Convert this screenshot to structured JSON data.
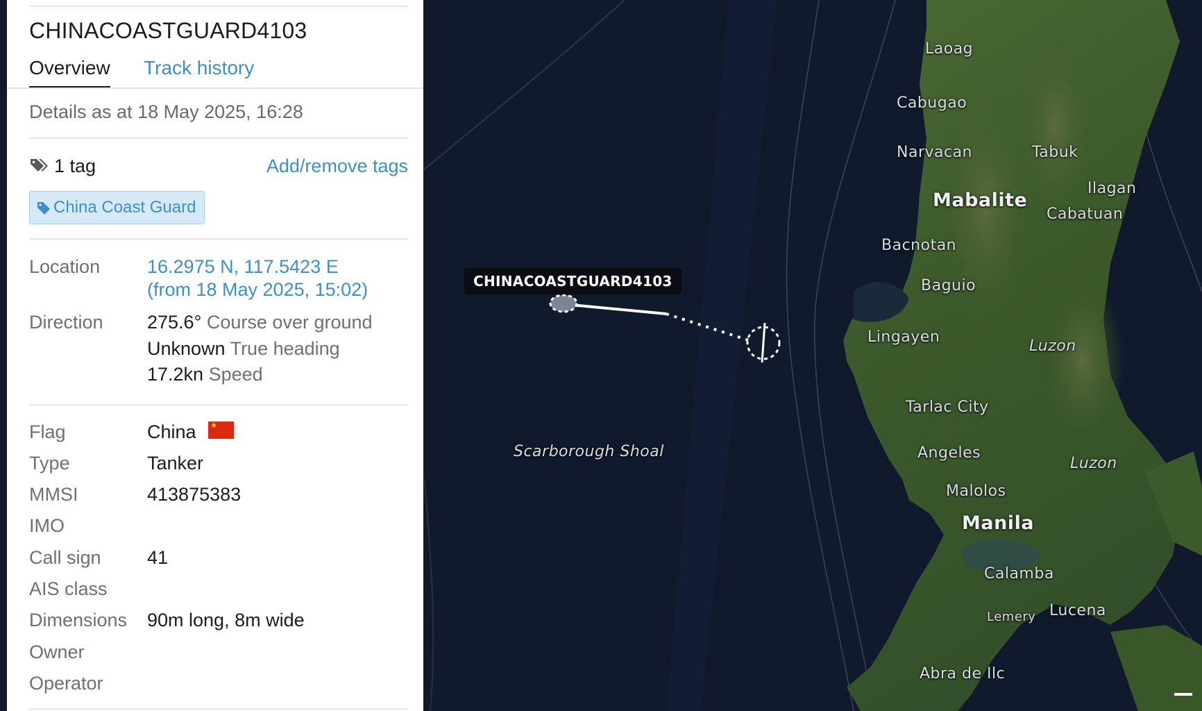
{
  "panel": {
    "vessel_name": "CHINACOASTGUARD4103",
    "tabs": [
      {
        "label": "Overview",
        "active": true
      },
      {
        "label": "Track history",
        "active": false
      }
    ],
    "details_as_at": "Details as at 18 May 2025, 16:28",
    "tags": {
      "count_label": "1 tag",
      "add_remove_label": "Add/remove tags",
      "items": [
        "China Coast Guard"
      ]
    },
    "location": {
      "label": "Location",
      "coords": "16.2975 N, 117.5423 E",
      "from": "(from 18 May 2025, 15:02)"
    },
    "direction": {
      "label": "Direction",
      "course_value": "275.6°",
      "course_label": "Course over ground",
      "heading_value": "Unknown",
      "heading_label": "True heading",
      "speed_value": "17.2kn",
      "speed_label": "Speed"
    },
    "fields": {
      "flag": {
        "label": "Flag",
        "value": "China"
      },
      "type": {
        "label": "Type",
        "value": "Tanker"
      },
      "mmsi": {
        "label": "MMSI",
        "value": "413875383"
      },
      "imo": {
        "label": "IMO",
        "value": ""
      },
      "call_sign": {
        "label": "Call sign",
        "value": "41"
      },
      "ais_class": {
        "label": "AIS class",
        "value": ""
      },
      "dimensions": {
        "label": "Dimensions",
        "value": "90m long, 8m wide"
      },
      "owner": {
        "label": "Owner",
        "value": ""
      },
      "operator": {
        "label": "Operator",
        "value": ""
      }
    }
  },
  "map": {
    "vessel_label": "CHINACOASTGUARD4103",
    "places": {
      "laoag": "Laoag",
      "cabugao": "Cabugao",
      "narvacan": "Narvacan",
      "tabuk": "Tabuk",
      "mabalite": "Mabalite",
      "ilagan": "Ilagan",
      "cabatuan": "Cabatuan",
      "bacnotan": "Bacnotan",
      "baguio": "Baguio",
      "lingayen": "Lingayen",
      "luzon_1": "Luzon",
      "tarlac": "Tarlac City",
      "angeles": "Angeles",
      "luzon_2": "Luzon",
      "malolos": "Malolos",
      "manila": "Manila",
      "calamba": "Calamba",
      "lemery": "Lemery",
      "lucena": "Lucena",
      "abra": "Abra de Ilc",
      "scarborough": "Scarborough Shoal"
    },
    "colors": {
      "sea": "#111a2c",
      "land": "#3e5a2a",
      "link": "#3d8fc4",
      "china_flag": "#de2910"
    }
  }
}
